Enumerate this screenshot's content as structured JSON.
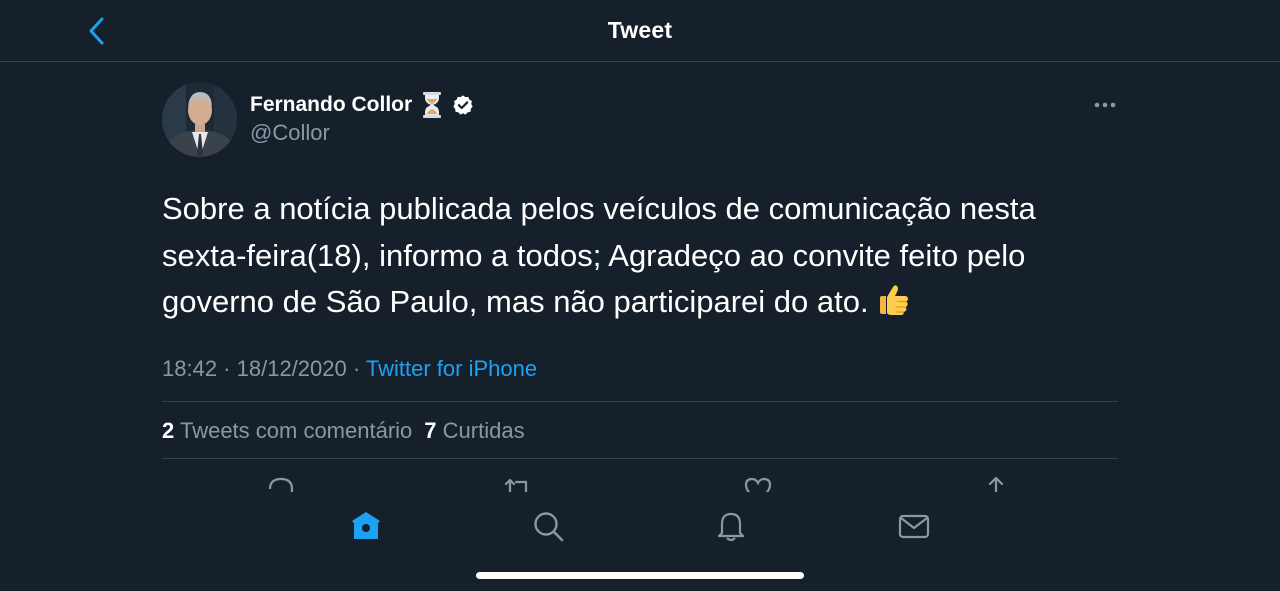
{
  "header": {
    "title": "Tweet",
    "back_icon": "chevron-left-icon"
  },
  "tweet": {
    "author_name": "Fernando Collor",
    "author_handle": "@Collor",
    "name_emoji_icon": "hourglass-icon",
    "verified_icon": "verified-badge-icon",
    "text": "Sobre a notícia publicada pelos  veículos de comunicação nesta sexta-feira(18), informo a todos; Agradeço ao convite feito pelo governo de São Paulo, mas não participarei do ato.",
    "text_emoji_icon": "thumbs-up-icon",
    "time": "18:42",
    "separator": " · ",
    "date": "18/12/2020",
    "source": "Twitter for iPhone"
  },
  "stats": {
    "retweets_count": "2",
    "retweets_label": "Tweets com comentário",
    "likes_count": "7",
    "likes_label": "Curtidas"
  },
  "actions": [
    "reply-icon",
    "retweet-icon",
    "like-icon",
    "share-icon"
  ],
  "tabbar": [
    "home-icon",
    "search-icon",
    "notifications-icon",
    "messages-icon"
  ],
  "colors": {
    "background": "#15202b",
    "accent": "#1da1f2",
    "secondary_text": "#8899a6",
    "divider": "#38444d"
  }
}
